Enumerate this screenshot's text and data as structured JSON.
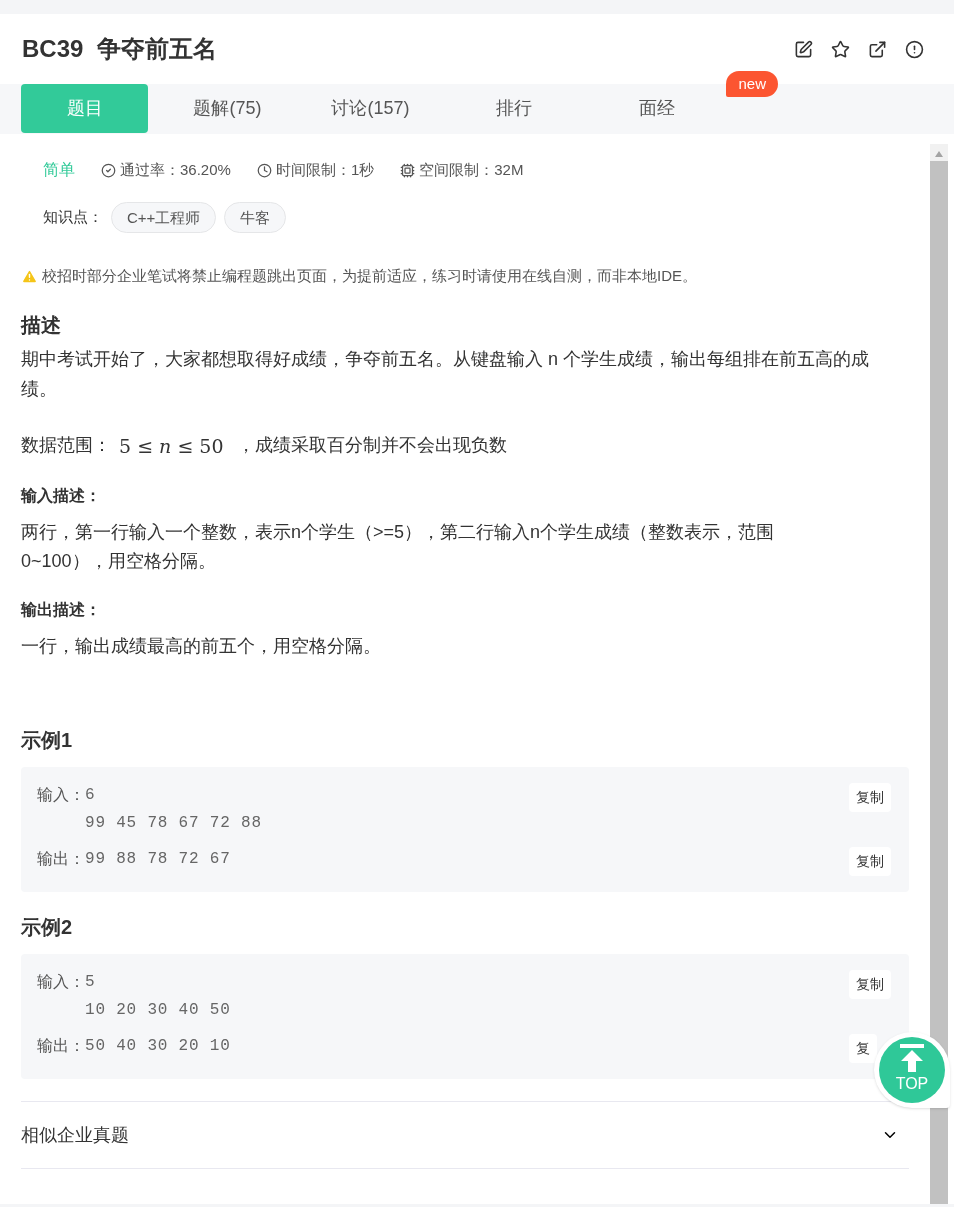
{
  "header": {
    "title": "BC39  争夺前五名"
  },
  "tabs": [
    {
      "label": "题目",
      "selected": true
    },
    {
      "label": "题解(75)",
      "selected": false
    },
    {
      "label": "讨论(157)",
      "selected": false
    },
    {
      "label": "排行",
      "selected": false
    },
    {
      "label": "面经",
      "selected": false,
      "badge": "new"
    }
  ],
  "meta": {
    "difficulty": "简单",
    "pass_rate": "通过率：36.20%",
    "time_limit": "时间限制：1秒",
    "space_limit": "空间限制：32M"
  },
  "knowledge": {
    "label": "知识点：",
    "tags": [
      "C++工程师",
      "牛客"
    ]
  },
  "notice": "校招时部分企业笔试将禁止编程题跳出页面，为提前适应，练习时请使用在线自测，而非本地IDE。",
  "description": {
    "heading": "描述",
    "text": "期中考试开始了，大家都想取得好成绩，争夺前五名。从键盘输入 n 个学生成绩，输出每组排在前五高的成绩。",
    "range_label": "数据范围：",
    "range_math": "5 ≤ *n* ≤ 50",
    "range_text": " ，成绩采取百分制并不会出现负数"
  },
  "input_desc": {
    "heading": "输入描述：",
    "text": "两行，第一行输入一个整数，表示n个学生（>=5），第二行输入n个学生成绩（整数表示，范围0~100），用空格分隔。"
  },
  "output_desc": {
    "heading": "输出描述：",
    "text": "一行，输出成绩最高的前五个，用空格分隔。"
  },
  "examples": [
    {
      "heading": "示例1",
      "input_label": "输入：",
      "input_lines": [
        "6",
        "99 45 78 67 72 88"
      ],
      "input_copy": "复制",
      "output_label": "输出：",
      "output": "99 88 78 72 67",
      "output_copy": "复制"
    },
    {
      "heading": "示例2",
      "input_label": "输入：",
      "input_lines": [
        "5",
        "10 20 30 40 50"
      ],
      "input_copy": "复制",
      "output_label": "输出：",
      "output": "50 40 30 20 10",
      "output_copy": "复"
    }
  ],
  "similar": {
    "label": "相似企业真题",
    "expanded": false
  },
  "top_button": {
    "label": "TOP"
  }
}
